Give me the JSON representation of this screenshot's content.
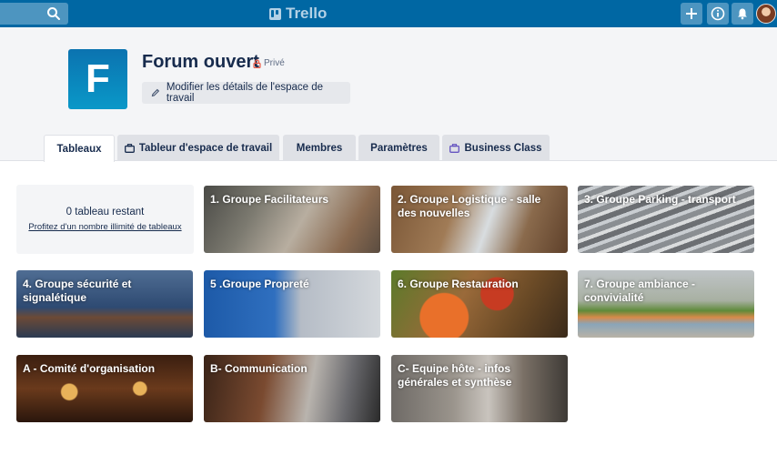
{
  "topbar": {
    "logo_text": "Trello",
    "search_icon": "search-icon",
    "buttons": [
      "plus-icon",
      "info-icon",
      "bell-icon"
    ],
    "colors": {
      "bar": "#0067a3",
      "button": "#4d95c0"
    }
  },
  "workspace": {
    "initial": "F",
    "name": "Forum ouvert",
    "visibility": "Privé",
    "edit_label": "Modifier les détails de l'espace de travail"
  },
  "tabs": [
    {
      "label": "Tableaux"
    },
    {
      "label": "Tableur d'espace de travail"
    },
    {
      "label": "Membres"
    },
    {
      "label": "Paramètres"
    },
    {
      "label": "Business Class"
    }
  ],
  "remaining": {
    "count_text": "0 tableau restant",
    "link_text": "Profitez d'un nombre illimité de tableaux"
  },
  "boards": [
    {
      "title": "1. Groupe Facilitateurs"
    },
    {
      "title": "2. Groupe Logistique - salle des nouvelles"
    },
    {
      "title": "3. Groupe Parking - transport"
    },
    {
      "title": "4. Groupe sécurité et signalétique"
    },
    {
      "title": "5 .Groupe Propreté"
    },
    {
      "title": "6. Groupe Restauration"
    },
    {
      "title": "7. Groupe ambiance - convivialité"
    },
    {
      "title": "A - Comité d'organisation"
    },
    {
      "title": "B- Communication"
    },
    {
      "title": "C- Equipe hôte - infos générales et synthèse"
    }
  ]
}
